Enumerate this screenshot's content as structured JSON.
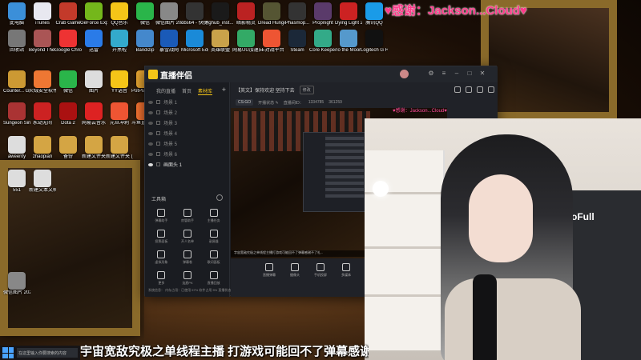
{
  "banner": {
    "thanks": "♥感谢：Jackson...Cloud♥",
    "thanks_mini": "♥感谢：Jackson...Cloud♥"
  },
  "desktop_icons": [
    {
      "label": "此电脑",
      "color": "#3b8fd9"
    },
    {
      "label": "iTunes",
      "color": "#e8e8f0"
    },
    {
      "label": "Crab Game",
      "color": "#c33a2a"
    },
    {
      "label": "GeForce Experience",
      "color": "#74b71b"
    },
    {
      "label": "QQ音乐",
      "color": "#f5c518"
    },
    {
      "label": "微信",
      "color": "#2ab54a"
    },
    {
      "label": "微信图片 2021111...",
      "color": "#888"
    },
    {
      "label": "obs64 - 快捷方式",
      "color": "#333"
    },
    {
      "label": "Ighub_inst...",
      "color": "#1a1a1a"
    },
    {
      "label": "暗影精灵",
      "color": "#b22"
    },
    {
      "label": "Dread Hunger",
      "color": "#553"
    },
    {
      "label": "Phasmop...",
      "color": "#333"
    },
    {
      "label": "Propnight",
      "color": "#5a3a6a"
    },
    {
      "label": "Dying Light 2",
      "color": "#c22"
    },
    {
      "label": "腾讯QQ",
      "color": "#1a9be8"
    },
    {
      "label": "回收站",
      "color": "#777"
    },
    {
      "label": "Beyond The Wire Sour...",
      "color": "#a55"
    },
    {
      "label": "Google Chrome",
      "color": "#e33"
    },
    {
      "label": "迅雷",
      "color": "#2a7be8"
    },
    {
      "label": "开黑啦",
      "color": "#3ac"
    },
    {
      "label": "Bandizip",
      "color": "#48c"
    },
    {
      "label": "暴雪战网",
      "color": "#1a5ab8"
    },
    {
      "label": "Microsoft Edge",
      "color": "#1a8ad8"
    },
    {
      "label": "英雄联盟",
      "color": "#c9a24a"
    },
    {
      "label": "网易UU加速器",
      "color": "#3a6"
    },
    {
      "label": "5E对战平台",
      "color": "#e53"
    },
    {
      "label": "Steam",
      "color": "#1b2838"
    },
    {
      "label": "Core Keeper 检...",
      "color": "#3a8"
    },
    {
      "label": "To the Moon",
      "color": "#59c"
    },
    {
      "label": "Logitech G HUB",
      "color": "#111"
    },
    {
      "label": "Counter... Global Off...",
      "color": "#c93"
    },
    {
      "label": "火绒安全软件",
      "color": "#e73"
    },
    {
      "label": "微信",
      "color": "#2ab54a"
    },
    {
      "label": "图片",
      "color": "#ddd"
    },
    {
      "label": "YY语音",
      "color": "#f5c518"
    },
    {
      "label": "PotPlayer 64 bit",
      "color": "#ea3"
    },
    {
      "label": "Sungeon Simulator 2",
      "color": "#a33"
    },
    {
      "label": "永劫无间",
      "color": "#c22"
    },
    {
      "label": "Dota 2",
      "color": "#a11"
    },
    {
      "label": "网易云音乐",
      "color": "#d22"
    },
    {
      "label": "元旦冲刺",
      "color": "#e53"
    },
    {
      "label": "斗鱼直播伴...",
      "color": "#f73"
    },
    {
      "label": "aweenty",
      "color": "#ddd"
    },
    {
      "label": "zhaopian",
      "color": "#d4a544"
    },
    {
      "label": "备份",
      "color": "#d4a544"
    },
    {
      "label": "新建文件夹",
      "color": "#d4a544"
    },
    {
      "label": "新建文件夹 (2)",
      "color": "#d4a544"
    },
    {
      "label": "551",
      "color": "#ddd"
    },
    {
      "label": "新建文本文档 (3)",
      "color": "#ddd"
    },
    {
      "label": "微信图片 202201...",
      "color": "#888"
    }
  ],
  "app": {
    "name": "直播伴侣",
    "sidebar_tabs": [
      "我的直播",
      "首页",
      "素材库"
    ],
    "active_tab_index": 2,
    "scenes": [
      "场景 1",
      "场景 2",
      "场景 3",
      "场景 4",
      "场景 5",
      "场景 6",
      "画面头 1"
    ],
    "active_scene_index": 6,
    "tools_title": "工具箱",
    "tools": [
      "弹幕助手",
      "房管助手",
      "主播任务",
      "投票面板",
      "开人名单",
      "录屏器",
      "虚拟形象",
      "弹幕卷",
      "歌词面板",
      "更多",
      "连麦PK",
      "直播回放"
    ],
    "footer": "系统信息：  内存占用：已使用 57% 软件占用 5%  直播状态",
    "header_title": "【英文】保持欢迎 坚持下去",
    "header_badge": "修改",
    "sub": {
      "game": "CS:GO",
      "status": "开播状态 ✎",
      "viewers_label": "直播间ID：",
      "viewers_value": "1334785",
      "likes_value": "361259"
    },
    "preview_caption": "字宙宽敌究极之单线程主播打游戏可能回不了弹幕感谢不了礼...",
    "actions": [
      "直播弹幕",
      "摄像头",
      "手机投屏",
      "多媒体"
    ]
  },
  "webcam": {
    "chair_brand": "oFull"
  },
  "caption": "宇宙宽敌究极之单线程主播 打游戏可能回不了弹幕感谢不了礼",
  "taskbar": {
    "search_placeholder": "在这里输入你要搜索的内容"
  }
}
